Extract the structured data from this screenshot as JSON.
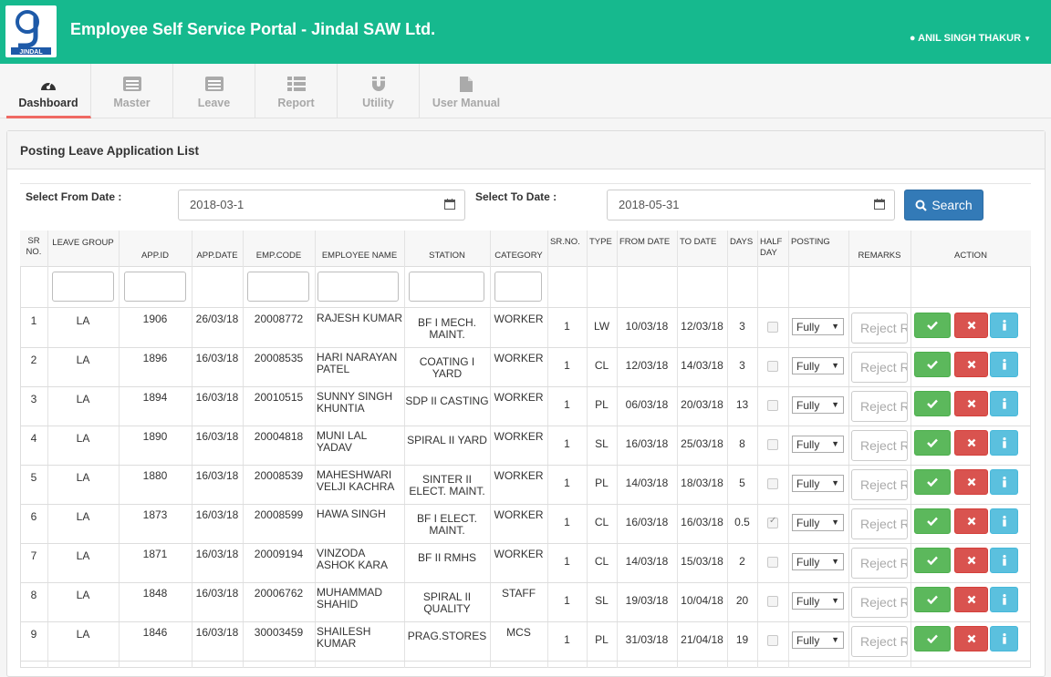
{
  "header": {
    "title": "Employee Self Service Portal - Jindal SAW Ltd.",
    "user": "ANIL SINGH THAKUR",
    "logo_text": "JINDAL",
    "accent": "#16b98e"
  },
  "nav": [
    {
      "label": "Dashboard",
      "icon": "dashboard-icon"
    },
    {
      "label": "Master",
      "icon": "list-icon"
    },
    {
      "label": "Leave",
      "icon": "list-icon"
    },
    {
      "label": "Report",
      "icon": "grid-list-icon"
    },
    {
      "label": "Utility",
      "icon": "magnet-icon"
    },
    {
      "label": "User Manual",
      "icon": "file-icon"
    }
  ],
  "panel": {
    "title": "Posting Leave Application List"
  },
  "filters": {
    "from_label": "Select From Date :",
    "from_value": "2018-03-1",
    "to_label": "Select To Date :",
    "to_value": "2018-05-31",
    "search_label": "Search"
  },
  "columns": [
    "SR NO.",
    "LEAVE GROUP",
    "APP.ID",
    "APP.DATE",
    "EMP.CODE",
    "EMPLOYEE NAME",
    "STATION",
    "CATEGORY",
    "SR.NO.",
    "TYPE",
    "FROM DATE",
    "TO DATE",
    "DAYS",
    "HALF DAY",
    "POSTING",
    "REMARKS",
    "ACTION"
  ],
  "remarks_placeholder": "Reject Remarks",
  "posting_option": "Fully",
  "rows": [
    {
      "sr": "1",
      "group": "LA",
      "app_id": "1906",
      "app_date": "26/03/18",
      "emp_code": "20008772",
      "name": "RAJESH KUMAR",
      "station": "BF I MECH. MAINT.",
      "category": "WORKER",
      "sr2": "1",
      "type": "LW",
      "from": "10/03/18",
      "to": "12/03/18",
      "days": "3",
      "half": false
    },
    {
      "sr": "2",
      "group": "LA",
      "app_id": "1896",
      "app_date": "16/03/18",
      "emp_code": "20008535",
      "name": "HARI NARAYAN PATEL",
      "station": "COATING I YARD",
      "category": "WORKER",
      "sr2": "1",
      "type": "CL",
      "from": "12/03/18",
      "to": "14/03/18",
      "days": "3",
      "half": false
    },
    {
      "sr": "3",
      "group": "LA",
      "app_id": "1894",
      "app_date": "16/03/18",
      "emp_code": "20010515",
      "name": "SUNNY SINGH KHUNTIA",
      "station": "SDP II CASTING",
      "category": "WORKER",
      "sr2": "1",
      "type": "PL",
      "from": "06/03/18",
      "to": "20/03/18",
      "days": "13",
      "half": false
    },
    {
      "sr": "4",
      "group": "LA",
      "app_id": "1890",
      "app_date": "16/03/18",
      "emp_code": "20004818",
      "name": "MUNI LAL YADAV",
      "station": "SPIRAL II YARD",
      "category": "WORKER",
      "sr2": "1",
      "type": "SL",
      "from": "16/03/18",
      "to": "25/03/18",
      "days": "8",
      "half": false
    },
    {
      "sr": "5",
      "group": "LA",
      "app_id": "1880",
      "app_date": "16/03/18",
      "emp_code": "20008539",
      "name": "MAHESHWARI VELJI KACHRA",
      "station": "SINTER II ELECT. MAINT.",
      "category": "WORKER",
      "sr2": "1",
      "type": "PL",
      "from": "14/03/18",
      "to": "18/03/18",
      "days": "5",
      "half": false
    },
    {
      "sr": "6",
      "group": "LA",
      "app_id": "1873",
      "app_date": "16/03/18",
      "emp_code": "20008599",
      "name": "HAWA SINGH",
      "station": "BF I ELECT. MAINT.",
      "category": "WORKER",
      "sr2": "1",
      "type": "CL",
      "from": "16/03/18",
      "to": "16/03/18",
      "days": "0.5",
      "half": true
    },
    {
      "sr": "7",
      "group": "LA",
      "app_id": "1871",
      "app_date": "16/03/18",
      "emp_code": "20009194",
      "name": "VINZODA ASHOK KARA",
      "station": "BF II RMHS",
      "category": "WORKER",
      "sr2": "1",
      "type": "CL",
      "from": "14/03/18",
      "to": "15/03/18",
      "days": "2",
      "half": false
    },
    {
      "sr": "8",
      "group": "LA",
      "app_id": "1848",
      "app_date": "16/03/18",
      "emp_code": "20006762",
      "name": "MUHAMMAD SHAHID",
      "station": "SPIRAL II QUALITY",
      "category": "STAFF",
      "sr2": "1",
      "type": "SL",
      "from": "19/03/18",
      "to": "10/04/18",
      "days": "20",
      "half": false
    },
    {
      "sr": "9",
      "group": "LA",
      "app_id": "1846",
      "app_date": "16/03/18",
      "emp_code": "30003459",
      "name": "SHAILESH KUMAR",
      "station": "PRAG.STORES",
      "category": "MCS",
      "sr2": "1",
      "type": "PL",
      "from": "31/03/18",
      "to": "21/04/18",
      "days": "19",
      "half": false
    }
  ]
}
